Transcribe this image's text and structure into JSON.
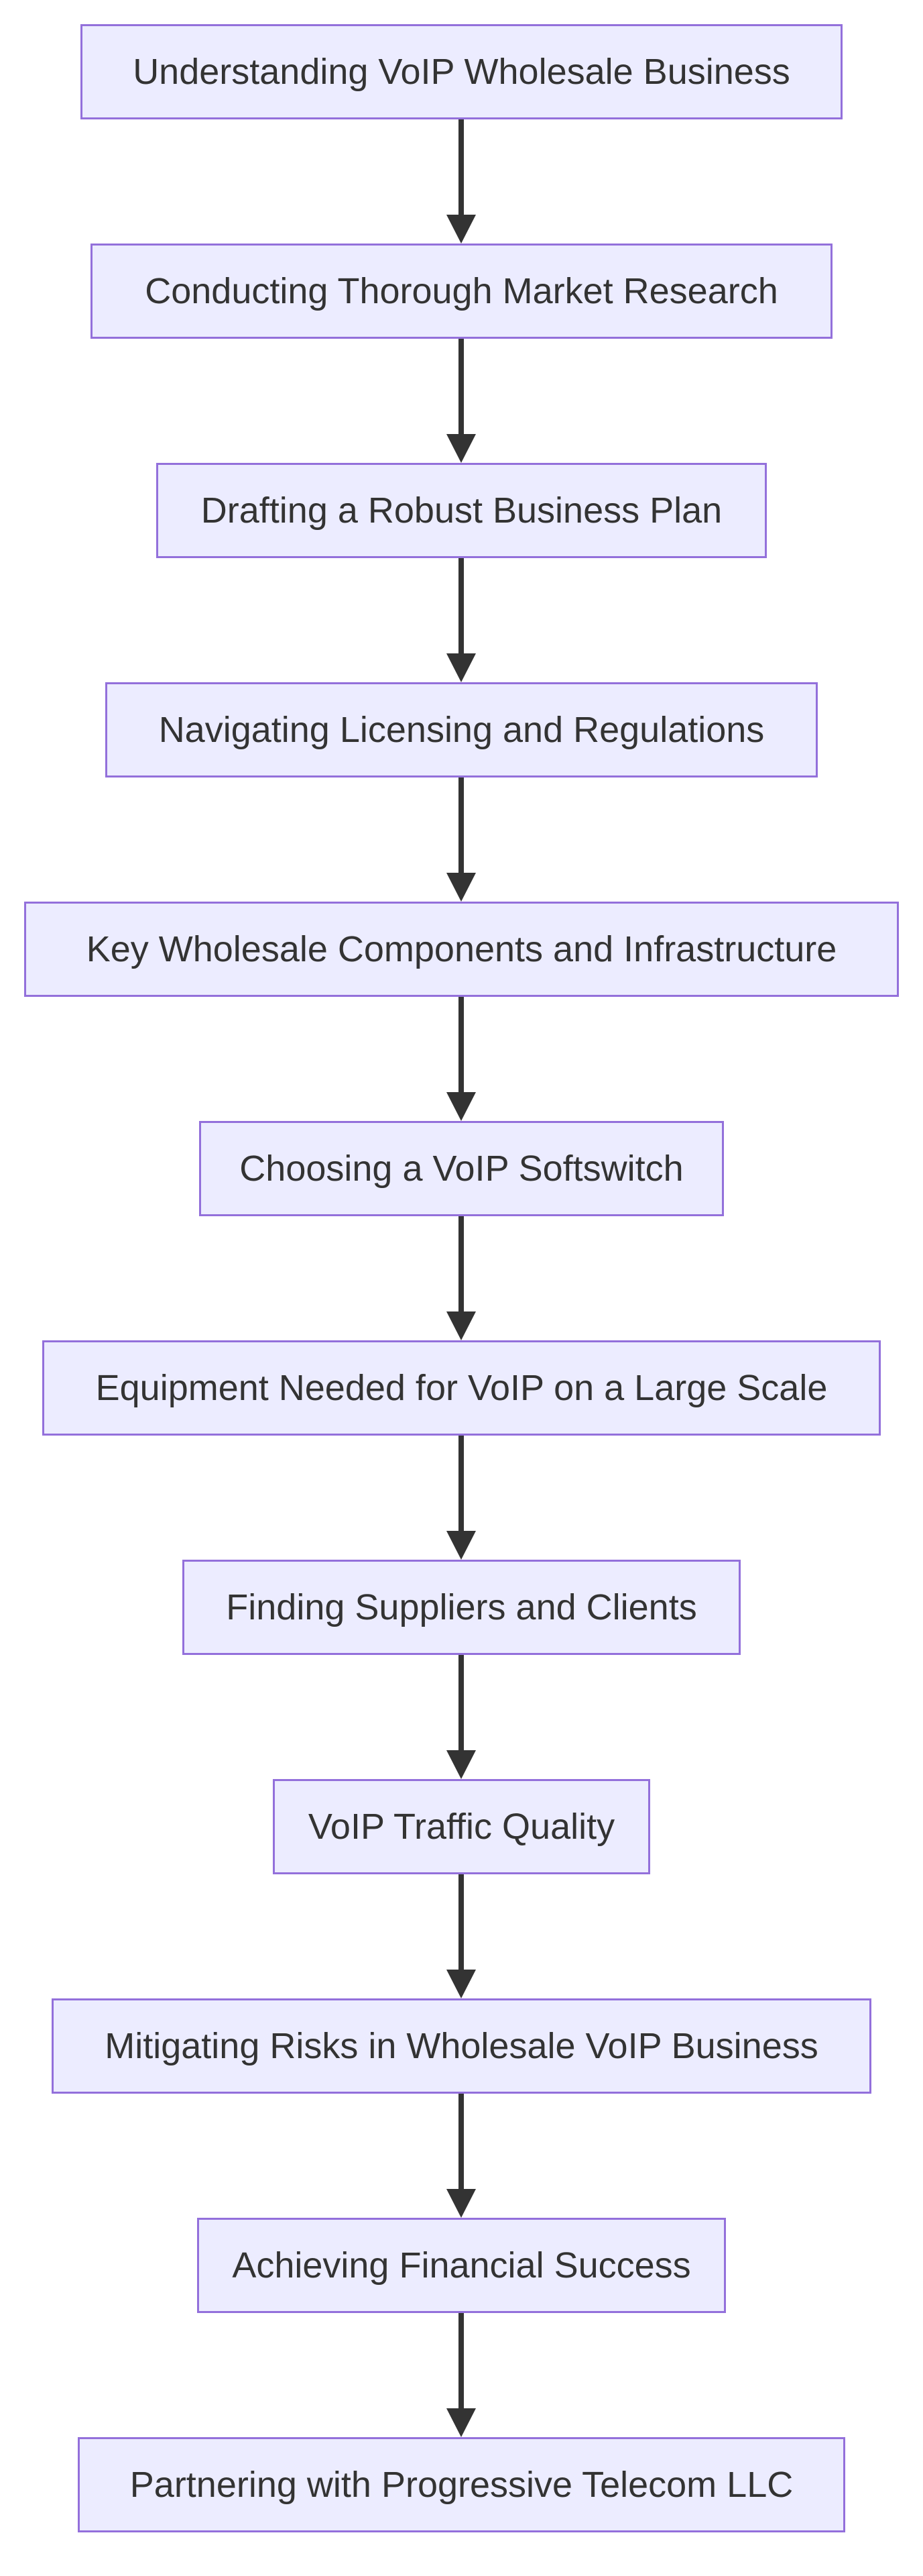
{
  "diagram": {
    "type": "flowchart",
    "direction": "top-down",
    "colors": {
      "node_fill": "#ECECFF",
      "node_border": "#9370DB",
      "text": "#333333",
      "edge": "#333333",
      "background": "#FFFFFF"
    },
    "nodes": [
      {
        "id": "n1",
        "label": "Understanding VoIP Wholesale Business"
      },
      {
        "id": "n2",
        "label": "Conducting Thorough Market Research"
      },
      {
        "id": "n3",
        "label": "Drafting a Robust Business Plan"
      },
      {
        "id": "n4",
        "label": "Navigating Licensing and Regulations"
      },
      {
        "id": "n5",
        "label": "Key Wholesale Components and Infrastructure"
      },
      {
        "id": "n6",
        "label": "Choosing a VoIP Softswitch"
      },
      {
        "id": "n7",
        "label": "Equipment Needed for VoIP on a Large Scale"
      },
      {
        "id": "n8",
        "label": "Finding Suppliers and Clients"
      },
      {
        "id": "n9",
        "label": "VoIP Traffic Quality"
      },
      {
        "id": "n10",
        "label": "Mitigating Risks in Wholesale VoIP Business"
      },
      {
        "id": "n11",
        "label": "Achieving Financial Success"
      },
      {
        "id": "n12",
        "label": "Partnering with Progressive Telecom LLC"
      }
    ],
    "edges": [
      {
        "from": "n1",
        "to": "n2"
      },
      {
        "from": "n2",
        "to": "n3"
      },
      {
        "from": "n3",
        "to": "n4"
      },
      {
        "from": "n4",
        "to": "n5"
      },
      {
        "from": "n5",
        "to": "n6"
      },
      {
        "from": "n6",
        "to": "n7"
      },
      {
        "from": "n7",
        "to": "n8"
      },
      {
        "from": "n8",
        "to": "n9"
      },
      {
        "from": "n9",
        "to": "n10"
      },
      {
        "from": "n10",
        "to": "n11"
      },
      {
        "from": "n11",
        "to": "n12"
      }
    ]
  }
}
